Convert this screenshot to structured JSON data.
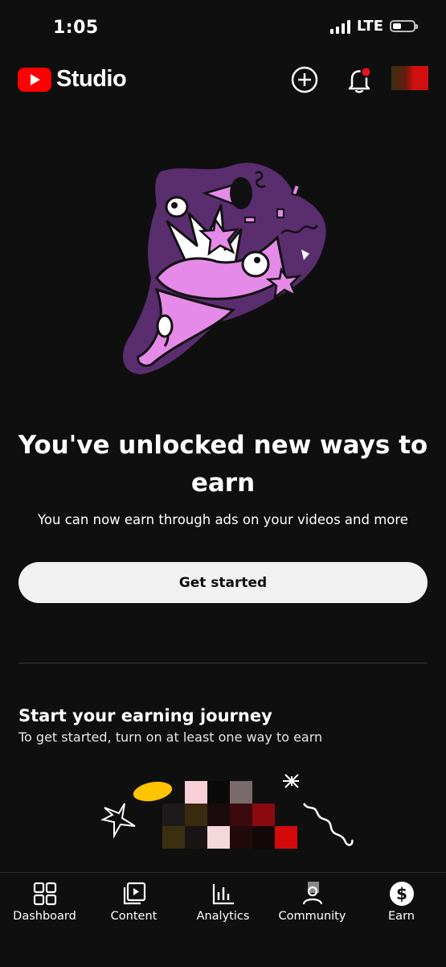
{
  "status_bar": {
    "time": "1:05",
    "network": "LTE",
    "battery_fraction": 0.35
  },
  "header": {
    "app_name": "Studio",
    "icons": [
      "create-icon",
      "notifications-icon",
      "avatar"
    ]
  },
  "hero": {
    "headline": "You've unlocked new ways to earn",
    "subtext": "You can now earn through ads on your videos and more",
    "cta_label": "Get started"
  },
  "journey": {
    "title": "Start your earning journey",
    "subtitle": "To get started, turn on at least one way to earn"
  },
  "bottom_nav": {
    "items": [
      {
        "label": "Dashboard",
        "icon": "dashboard-icon"
      },
      {
        "label": "Content",
        "icon": "content-icon"
      },
      {
        "label": "Analytics",
        "icon": "analytics-icon"
      },
      {
        "label": "Community",
        "icon": "community-icon"
      },
      {
        "label": "Earn",
        "icon": "earn-icon"
      }
    ],
    "active": "Earn"
  },
  "colors": {
    "background": "#0f0f0f",
    "brand_red": "#ff0000",
    "illustration_purple": "#5a2d6e",
    "illustration_pink": "#e58ae8",
    "coin": "#ffcc00"
  }
}
